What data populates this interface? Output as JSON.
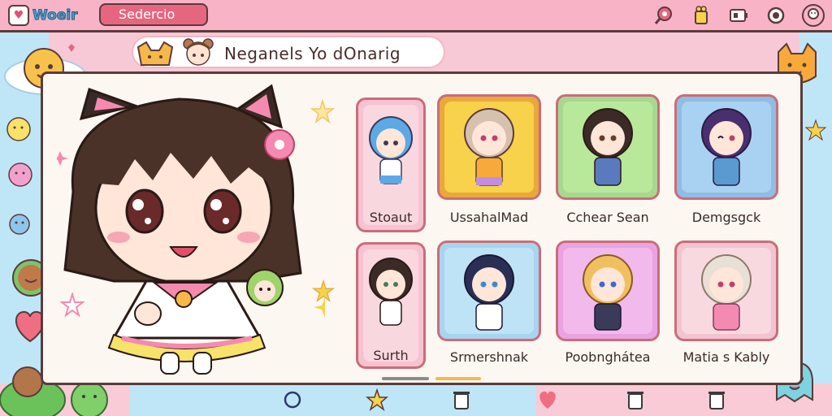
{
  "app": {
    "logo_text": "Woeir",
    "search_label": "Sedercio"
  },
  "top_icons": [
    "pin-icon",
    "cup-icon",
    "battery-icon",
    "settings-icon",
    "profile-icon"
  ],
  "header": {
    "title": "Neganels Yo dOnarig"
  },
  "hero": {
    "name": "featured-character"
  },
  "cards": [
    {
      "name": "Stoaut",
      "color": "#f9d7df",
      "hair": "#5da9e6"
    },
    {
      "name": "UssahalMad",
      "color": "#f7d24a",
      "hair": "#d6c1b0"
    },
    {
      "name": "Cchear Sean",
      "color": "#b8e89a",
      "hair": "#3b2a25"
    },
    {
      "name": "Demgsgck",
      "color": "#a9d2f2",
      "hair": "#4a2f6e"
    },
    {
      "name": "Surth",
      "color": "#f9d7df",
      "hair": "#3b2a25"
    },
    {
      "name": "Srmershnak",
      "color": "#bfe3f6",
      "hair": "#2a2f55"
    },
    {
      "name": "Poobnghátea",
      "color": "#f2b9ec",
      "hair": "#f0c060"
    },
    {
      "name": "Matia s Kably",
      "color": "#f8d9e0",
      "hair": "#e8e0d6"
    }
  ],
  "bottom_nav": [
    "circle-icon",
    "star-icon",
    "trash-icon",
    "heart-icon",
    "trash-icon",
    "trash-icon"
  ],
  "colors": {
    "accent": "#e7667f",
    "border": "#5a3b3b",
    "panel": "#fdf7f2"
  }
}
